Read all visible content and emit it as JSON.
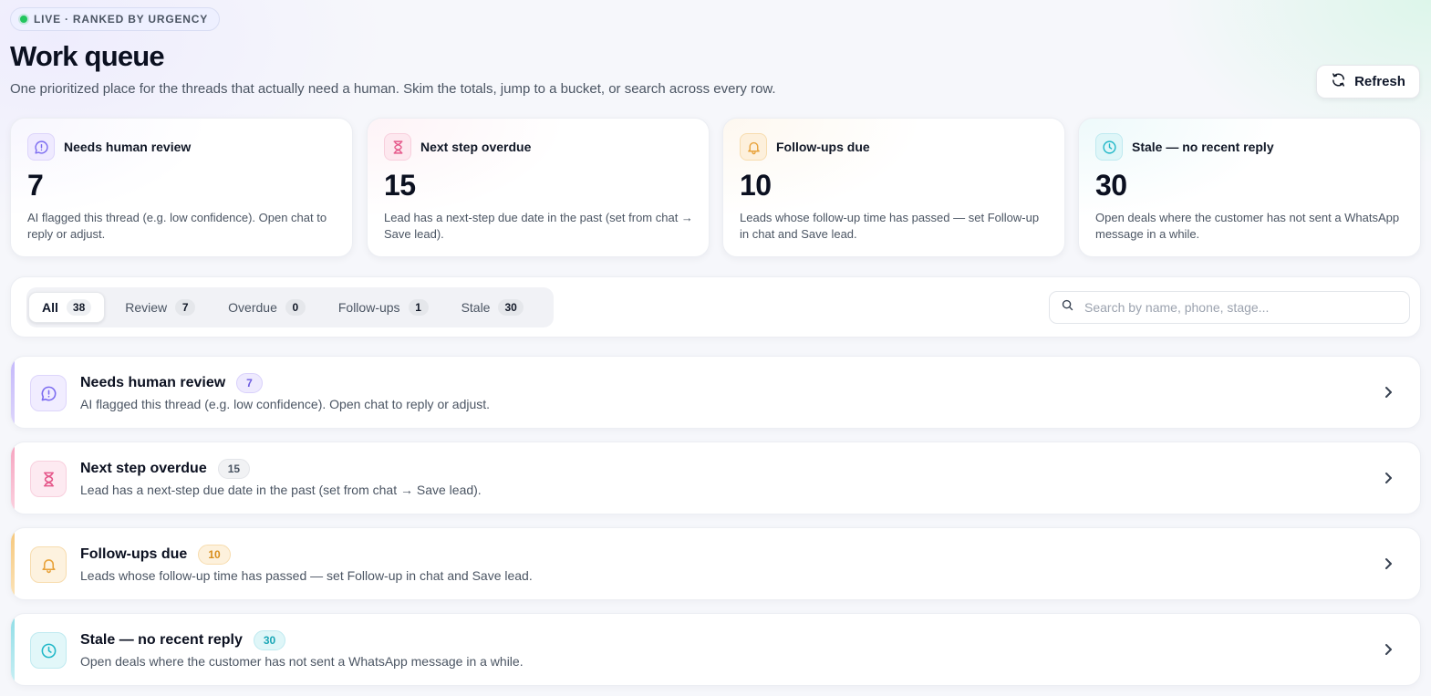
{
  "header": {
    "live_label": "LIVE · RANKED BY URGENCY",
    "title": "Work queue",
    "subtitle": "One prioritized place for the threads that actually need a human. Skim the totals, jump to a bucket, or search across every row.",
    "refresh_label": "Refresh"
  },
  "stats": [
    {
      "label": "Needs human review",
      "value": "7",
      "desc": "AI flagged this thread (e.g. low confidence). Open chat to reply or adjust.",
      "icon": "chat-alert-icon",
      "color": "#7c6cf0"
    },
    {
      "label": "Next step overdue",
      "value": "15",
      "desc": "Lead has a next-step due date in the past (set from chat → Save lead).",
      "icon": "hourglass-icon",
      "color": "#e5578a"
    },
    {
      "label": "Follow-ups due",
      "value": "10",
      "desc": "Leads whose follow-up time has passed — set Follow-up in chat and Save lead.",
      "icon": "bell-icon",
      "color": "#e8a23a"
    },
    {
      "label": "Stale — no recent reply",
      "value": "30",
      "desc": "Open deals where the customer has not sent a WhatsApp message in a while.",
      "icon": "clock-icon",
      "color": "#22b8c8"
    }
  ],
  "tabs": [
    {
      "label": "All",
      "count": "38"
    },
    {
      "label": "Review",
      "count": "7"
    },
    {
      "label": "Overdue",
      "count": "0"
    },
    {
      "label": "Follow-ups",
      "count": "1"
    },
    {
      "label": "Stale",
      "count": "30"
    }
  ],
  "search": {
    "placeholder": "Search by name, phone, stage..."
  },
  "buckets": [
    {
      "title": "Needs human review",
      "count": "7",
      "desc": "AI flagged this thread (e.g. low confidence). Open chat to reply or adjust."
    },
    {
      "title": "Next step overdue",
      "count": "15",
      "desc": "Lead has a next-step due date in the past (set from chat → Save lead)."
    },
    {
      "title": "Follow-ups due",
      "count": "10",
      "desc": "Leads whose follow-up time has passed — set Follow-up in chat and Save lead."
    },
    {
      "title": "Stale — no recent reply",
      "count": "30",
      "desc": "Open deals where the customer has not sent a WhatsApp message in a while."
    }
  ],
  "colors": {
    "review": "#7c6cf0",
    "overdue": "#e5578a",
    "followup": "#e8a23a",
    "stale": "#22b8c8",
    "live": "#22c55e"
  }
}
